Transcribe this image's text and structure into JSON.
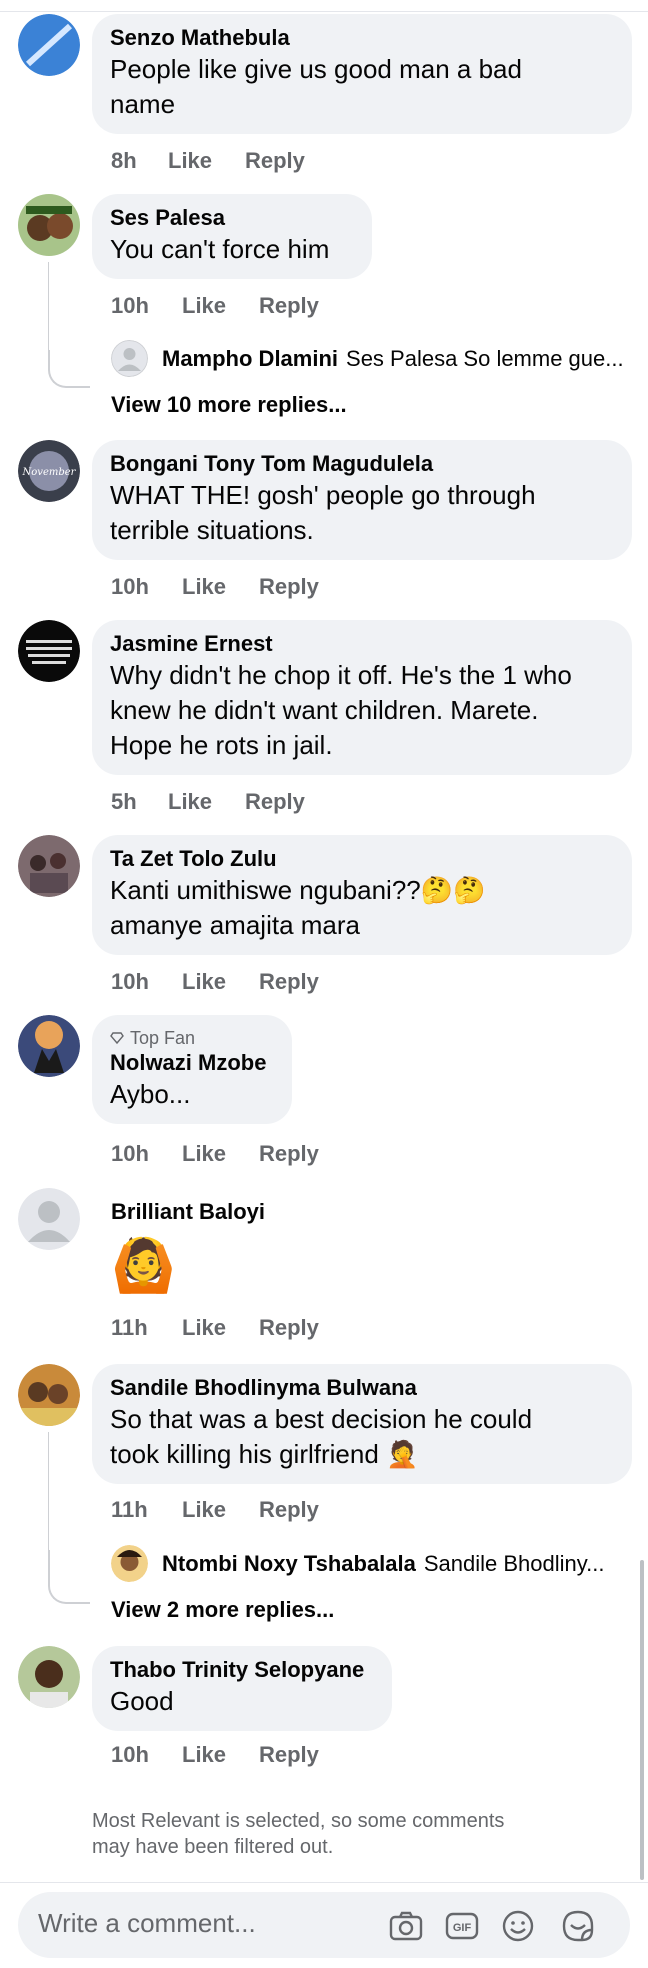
{
  "comments": [
    {
      "name": "Senzo Mathebula",
      "text_lines": [
        "People like give us good man a bad",
        "name"
      ],
      "time": "8h",
      "like": "Like",
      "reply": "Reply"
    },
    {
      "name": "Ses Palesa",
      "text_lines": [
        "You can't force him"
      ],
      "time": "10h",
      "like": "Like",
      "reply": "Reply",
      "subreply": {
        "name": "Mampho Dlamini",
        "text": "Ses Palesa So lemme gue..."
      },
      "view_more": "View 10 more replies..."
    },
    {
      "name": "Bongani Tony Tom Magudulela",
      "text_lines": [
        "WHAT THE! gosh' people go through",
        "terrible situations."
      ],
      "time": "10h",
      "like": "Like",
      "reply": "Reply"
    },
    {
      "name": "Jasmine Ernest",
      "text_lines": [
        "Why didn't he chop it off. He's the 1 who",
        "knew he didn't want children. Marete.",
        "Hope he rots in jail."
      ],
      "time": "5h",
      "like": "Like",
      "reply": "Reply"
    },
    {
      "name": "Ta Zet Tolo Zulu",
      "text_lines": [
        "Kanti umithiswe ngubani??🤔🤔",
        "amanye amajita mara"
      ],
      "time": "10h",
      "like": "Like",
      "reply": "Reply"
    },
    {
      "badge": "Top Fan",
      "name": "Nolwazi Mzobe",
      "text_lines": [
        "Aybo..."
      ],
      "time": "10h",
      "like": "Like",
      "reply": "Reply"
    },
    {
      "name": "Brilliant Baloyi",
      "emoji": "🙆",
      "time": "11h",
      "like": "Like",
      "reply": "Reply"
    },
    {
      "name": "Sandile Bhodlinyma Bulwana",
      "text_lines": [
        "So that was a best decision he could",
        "took killing his girlfriend 🤦"
      ],
      "time": "11h",
      "like": "Like",
      "reply": "Reply",
      "subreply": {
        "name": "Ntombi Noxy Tshabalala",
        "text": "Sandile Bhodliny..."
      },
      "view_more": "View 2 more replies..."
    },
    {
      "name": "Thabo Trinity Selopyane",
      "text_lines": [
        "Good"
      ],
      "time": "10h",
      "like": "Like",
      "reply": "Reply"
    }
  ],
  "footer_note_lines": [
    "Most Relevant is selected, so some comments",
    "may have been filtered out."
  ],
  "composer": {
    "placeholder": "Write a comment...",
    "icons": [
      "camera-icon",
      "gif-icon",
      "smiley-icon",
      "sticker-icon"
    ]
  },
  "colors": {
    "bubble": "#f0f2f5",
    "secondary_text": "#65676b"
  }
}
